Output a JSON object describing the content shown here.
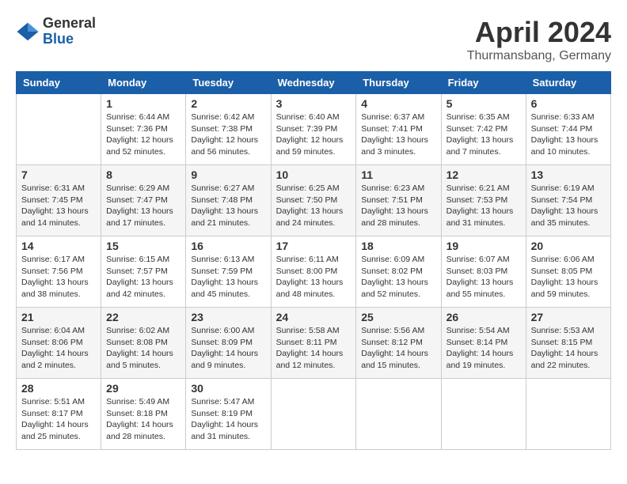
{
  "header": {
    "logo": {
      "general": "General",
      "blue": "Blue"
    },
    "title": "April 2024",
    "location": "Thurmansbang, Germany"
  },
  "calendar": {
    "days_of_week": [
      "Sunday",
      "Monday",
      "Tuesday",
      "Wednesday",
      "Thursday",
      "Friday",
      "Saturday"
    ],
    "weeks": [
      [
        {
          "day": "",
          "info": ""
        },
        {
          "day": "1",
          "info": "Sunrise: 6:44 AM\nSunset: 7:36 PM\nDaylight: 12 hours\nand 52 minutes."
        },
        {
          "day": "2",
          "info": "Sunrise: 6:42 AM\nSunset: 7:38 PM\nDaylight: 12 hours\nand 56 minutes."
        },
        {
          "day": "3",
          "info": "Sunrise: 6:40 AM\nSunset: 7:39 PM\nDaylight: 12 hours\nand 59 minutes."
        },
        {
          "day": "4",
          "info": "Sunrise: 6:37 AM\nSunset: 7:41 PM\nDaylight: 13 hours\nand 3 minutes."
        },
        {
          "day": "5",
          "info": "Sunrise: 6:35 AM\nSunset: 7:42 PM\nDaylight: 13 hours\nand 7 minutes."
        },
        {
          "day": "6",
          "info": "Sunrise: 6:33 AM\nSunset: 7:44 PM\nDaylight: 13 hours\nand 10 minutes."
        }
      ],
      [
        {
          "day": "7",
          "info": "Sunrise: 6:31 AM\nSunset: 7:45 PM\nDaylight: 13 hours\nand 14 minutes."
        },
        {
          "day": "8",
          "info": "Sunrise: 6:29 AM\nSunset: 7:47 PM\nDaylight: 13 hours\nand 17 minutes."
        },
        {
          "day": "9",
          "info": "Sunrise: 6:27 AM\nSunset: 7:48 PM\nDaylight: 13 hours\nand 21 minutes."
        },
        {
          "day": "10",
          "info": "Sunrise: 6:25 AM\nSunset: 7:50 PM\nDaylight: 13 hours\nand 24 minutes."
        },
        {
          "day": "11",
          "info": "Sunrise: 6:23 AM\nSunset: 7:51 PM\nDaylight: 13 hours\nand 28 minutes."
        },
        {
          "day": "12",
          "info": "Sunrise: 6:21 AM\nSunset: 7:53 PM\nDaylight: 13 hours\nand 31 minutes."
        },
        {
          "day": "13",
          "info": "Sunrise: 6:19 AM\nSunset: 7:54 PM\nDaylight: 13 hours\nand 35 minutes."
        }
      ],
      [
        {
          "day": "14",
          "info": "Sunrise: 6:17 AM\nSunset: 7:56 PM\nDaylight: 13 hours\nand 38 minutes."
        },
        {
          "day": "15",
          "info": "Sunrise: 6:15 AM\nSunset: 7:57 PM\nDaylight: 13 hours\nand 42 minutes."
        },
        {
          "day": "16",
          "info": "Sunrise: 6:13 AM\nSunset: 7:59 PM\nDaylight: 13 hours\nand 45 minutes."
        },
        {
          "day": "17",
          "info": "Sunrise: 6:11 AM\nSunset: 8:00 PM\nDaylight: 13 hours\nand 48 minutes."
        },
        {
          "day": "18",
          "info": "Sunrise: 6:09 AM\nSunset: 8:02 PM\nDaylight: 13 hours\nand 52 minutes."
        },
        {
          "day": "19",
          "info": "Sunrise: 6:07 AM\nSunset: 8:03 PM\nDaylight: 13 hours\nand 55 minutes."
        },
        {
          "day": "20",
          "info": "Sunrise: 6:06 AM\nSunset: 8:05 PM\nDaylight: 13 hours\nand 59 minutes."
        }
      ],
      [
        {
          "day": "21",
          "info": "Sunrise: 6:04 AM\nSunset: 8:06 PM\nDaylight: 14 hours\nand 2 minutes."
        },
        {
          "day": "22",
          "info": "Sunrise: 6:02 AM\nSunset: 8:08 PM\nDaylight: 14 hours\nand 5 minutes."
        },
        {
          "day": "23",
          "info": "Sunrise: 6:00 AM\nSunset: 8:09 PM\nDaylight: 14 hours\nand 9 minutes."
        },
        {
          "day": "24",
          "info": "Sunrise: 5:58 AM\nSunset: 8:11 PM\nDaylight: 14 hours\nand 12 minutes."
        },
        {
          "day": "25",
          "info": "Sunrise: 5:56 AM\nSunset: 8:12 PM\nDaylight: 14 hours\nand 15 minutes."
        },
        {
          "day": "26",
          "info": "Sunrise: 5:54 AM\nSunset: 8:14 PM\nDaylight: 14 hours\nand 19 minutes."
        },
        {
          "day": "27",
          "info": "Sunrise: 5:53 AM\nSunset: 8:15 PM\nDaylight: 14 hours\nand 22 minutes."
        }
      ],
      [
        {
          "day": "28",
          "info": "Sunrise: 5:51 AM\nSunset: 8:17 PM\nDaylight: 14 hours\nand 25 minutes."
        },
        {
          "day": "29",
          "info": "Sunrise: 5:49 AM\nSunset: 8:18 PM\nDaylight: 14 hours\nand 28 minutes."
        },
        {
          "day": "30",
          "info": "Sunrise: 5:47 AM\nSunset: 8:19 PM\nDaylight: 14 hours\nand 31 minutes."
        },
        {
          "day": "",
          "info": ""
        },
        {
          "day": "",
          "info": ""
        },
        {
          "day": "",
          "info": ""
        },
        {
          "day": "",
          "info": ""
        }
      ]
    ]
  }
}
